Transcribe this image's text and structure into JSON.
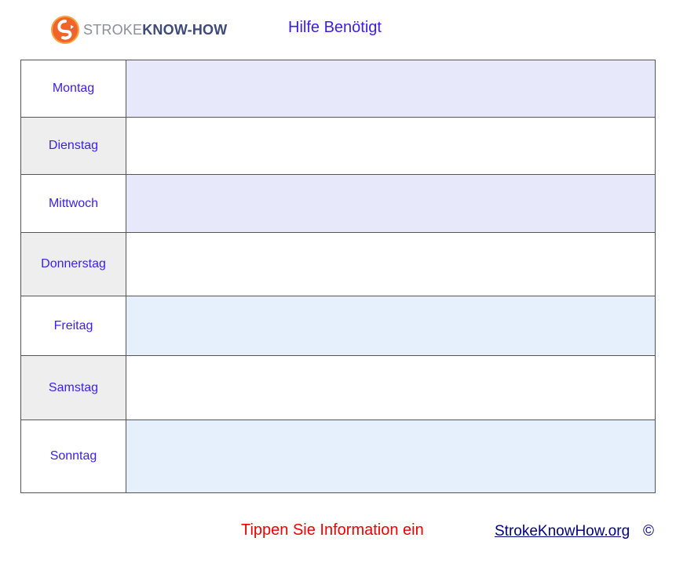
{
  "header": {
    "logo_part1": "STROKE",
    "logo_part2": "KNOW-HOW",
    "title": "Hilfe Benötigt"
  },
  "days": [
    {
      "label": "Montag",
      "value": ""
    },
    {
      "label": "Dienstag",
      "value": ""
    },
    {
      "label": "Mittwoch",
      "value": ""
    },
    {
      "label": "Donnerstag",
      "value": ""
    },
    {
      "label": "Freitag",
      "value": ""
    },
    {
      "label": "Samstag",
      "value": ""
    },
    {
      "label": "Sonntag",
      "value": ""
    }
  ],
  "footer": {
    "hint": "Tippen Sie Information ein",
    "link": "StrokeKnowHow.org",
    "copyright": "©"
  },
  "colors": {
    "accent_text": "#3a1fe8",
    "hint_text": "#ee0000",
    "row_tint_lavender": "#e8e8fb",
    "row_tint_blue": "#e6effc",
    "day_grey": "#eeeeee",
    "logo_orange": "#f0642a"
  },
  "icons": {
    "logo": "stroke-know-how-logo-icon"
  }
}
